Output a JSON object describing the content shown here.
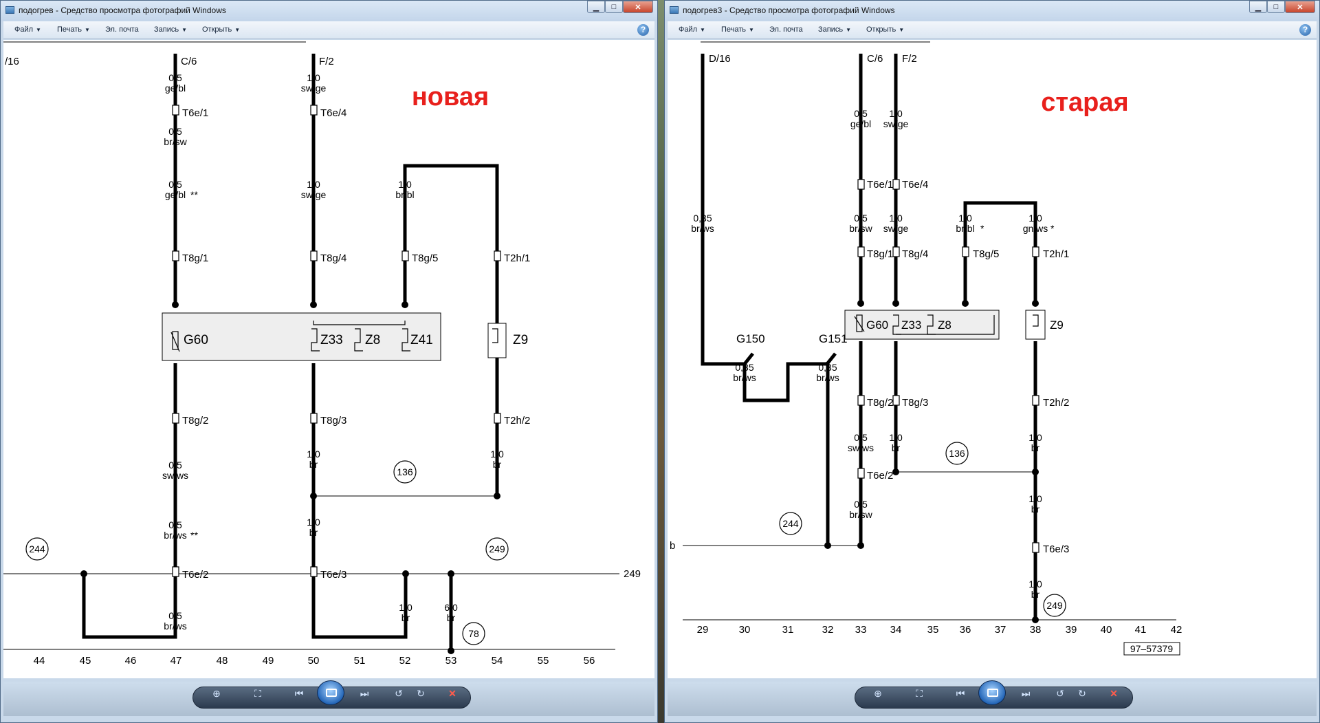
{
  "left_window": {
    "title": "подогрев - Средство просмотра фотографий Windows",
    "menu": {
      "file": "Файл",
      "print": "Печать",
      "email": "Эл. почта",
      "burn": "Запись",
      "open": "Открыть"
    },
    "help": "?",
    "diagram": {
      "overlay_label": "новая",
      "axis_numbers": [
        "44",
        "45",
        "46",
        "47",
        "48",
        "49",
        "50",
        "51",
        "52",
        "53",
        "54",
        "55",
        "56"
      ],
      "wire_labels": [
        "0,5 ge/bl",
        "0,5 br/sw",
        "0,5 ge/bl **",
        "0,5 sw/ws",
        "0,5 br/ws **",
        "0,5 br/ws",
        "1,0 sw/ge",
        "1,0 sw/ge",
        "1,0 br",
        "1,0 br",
        "1,0 br/bl",
        "1,0 br",
        "6,0 br",
        "1,0 br"
      ],
      "connectors": [
        "C/6",
        "F/2",
        "T6e/1",
        "T6e/4",
        "T8g/1",
        "T8g/4",
        "T8g/5",
        "T2h/1",
        "T8g/2",
        "T8g/3",
        "T2h/2",
        "T6e/2",
        "T6e/3"
      ],
      "components": [
        "G60",
        "Z33",
        "Z8",
        "Z41",
        "Z9"
      ],
      "refs": [
        "136",
        "244",
        "249",
        "78"
      ],
      "edge_labels": [
        "/16",
        "249"
      ]
    }
  },
  "right_window": {
    "title": "подогрев3 - Средство просмотра фотографий Windows",
    "menu": {
      "file": "Файл",
      "print": "Печать",
      "email": "Эл. почта",
      "burn": "Запись",
      "open": "Открыть"
    },
    "help": "?",
    "diagram": {
      "overlay_label": "старая",
      "axis_numbers": [
        "29",
        "30",
        "31",
        "32",
        "33",
        "34",
        "35",
        "36",
        "37",
        "38",
        "39",
        "40",
        "41",
        "42"
      ],
      "wire_labels": [
        "0,35 br/ws",
        "0,35 br/ws",
        "0,35 br/ws",
        "0,5 ge/bl",
        "0,5 br/sw",
        "0,5 sw/ws",
        "0,5 br/sw",
        "1,0 sw/ge",
        "1,0 sw/ge",
        "1,0 br",
        "1,0 br/bl *",
        "1,0 gn/ws *",
        "1,0 br",
        "1,0 br",
        "1,0 br"
      ],
      "connectors": [
        "D/16",
        "C/6",
        "F/2",
        "T6e/1",
        "T6e/4",
        "T8g/1",
        "T8g/4",
        "T8g/5",
        "T2h/1",
        "T8g/2",
        "T8g/3",
        "T6e/2",
        "T2h/2",
        "T6e/3"
      ],
      "components": [
        "G150",
        "G151",
        "G60",
        "Z33",
        "Z8",
        "Z9"
      ],
      "refs": [
        "136",
        "244",
        "249"
      ],
      "edge_labels": [
        "b"
      ],
      "doc_number": "97–57379"
    }
  }
}
